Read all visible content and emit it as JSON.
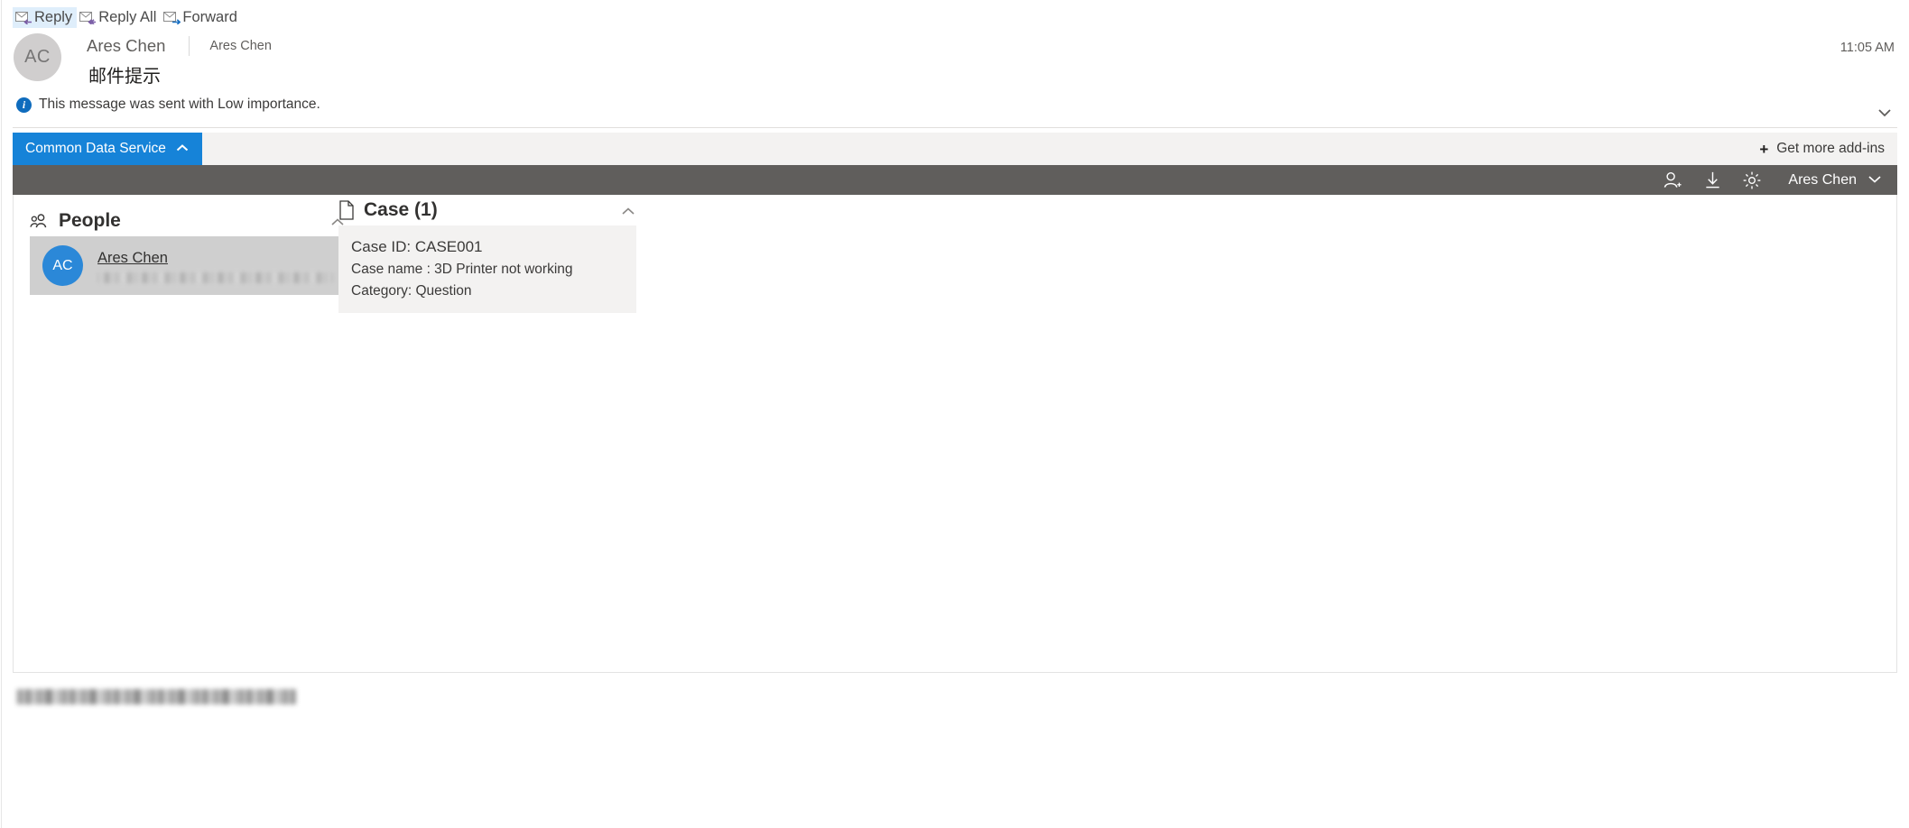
{
  "message_toolbar": {
    "buttons": [
      {
        "label": "Reply",
        "icon": "reply-envelope-icon",
        "state": "hover"
      },
      {
        "label": "Reply All",
        "icon": "reply-all-envelope-icon",
        "state": "normal"
      },
      {
        "label": "Forward",
        "icon": "forward-envelope-icon",
        "state": "normal"
      }
    ]
  },
  "message": {
    "avatar_initials": "AC",
    "sender_name": "Ares Chen",
    "sender_alias": "Ares Chen",
    "timestamp": "11:05 AM",
    "subject": "邮件提示",
    "importance_notice": "This message was sent with Low importance.",
    "importance_icon": "info-circle-icon",
    "expand_icon": "chevron-down-icon"
  },
  "addin_strip": {
    "active_tab": "Common Data Service",
    "active_tab_icon": "chevron-up-icon",
    "get_more_label": "Get more add-ins",
    "get_more_icon": "plus-icon"
  },
  "command_bar": {
    "icons": [
      {
        "name": "add-person-icon"
      },
      {
        "name": "download-icon"
      },
      {
        "name": "gear-icon"
      }
    ],
    "user_label": "Ares Chen",
    "user_chevron": "chevron-down-icon"
  },
  "panel": {
    "people": {
      "icon": "people-icon",
      "title": "People",
      "collapse_icon": "chevron-up-icon",
      "card": {
        "avatar_initials": "AC",
        "name": "Ares Chen",
        "email_redacted": true
      }
    },
    "case": {
      "icon": "document-icon",
      "title": "Case (1)",
      "collapse_icon": "chevron-up-icon",
      "card": {
        "case_id": "Case ID: CASE001",
        "case_name": "Case name : 3D Printer not working",
        "category": "Category: Question"
      }
    }
  },
  "footer": {
    "redacted_text": true
  },
  "colors": {
    "tab_blue": "#1683d8",
    "command_bar_gray": "#605e5c",
    "strip_gray": "#f3f2f1",
    "card_selected_gray": "#cfcfcf",
    "card_light_gray": "#f3f2f1",
    "avatar_blue": "#2b88d8",
    "avatar_gray": "#d0cece"
  }
}
